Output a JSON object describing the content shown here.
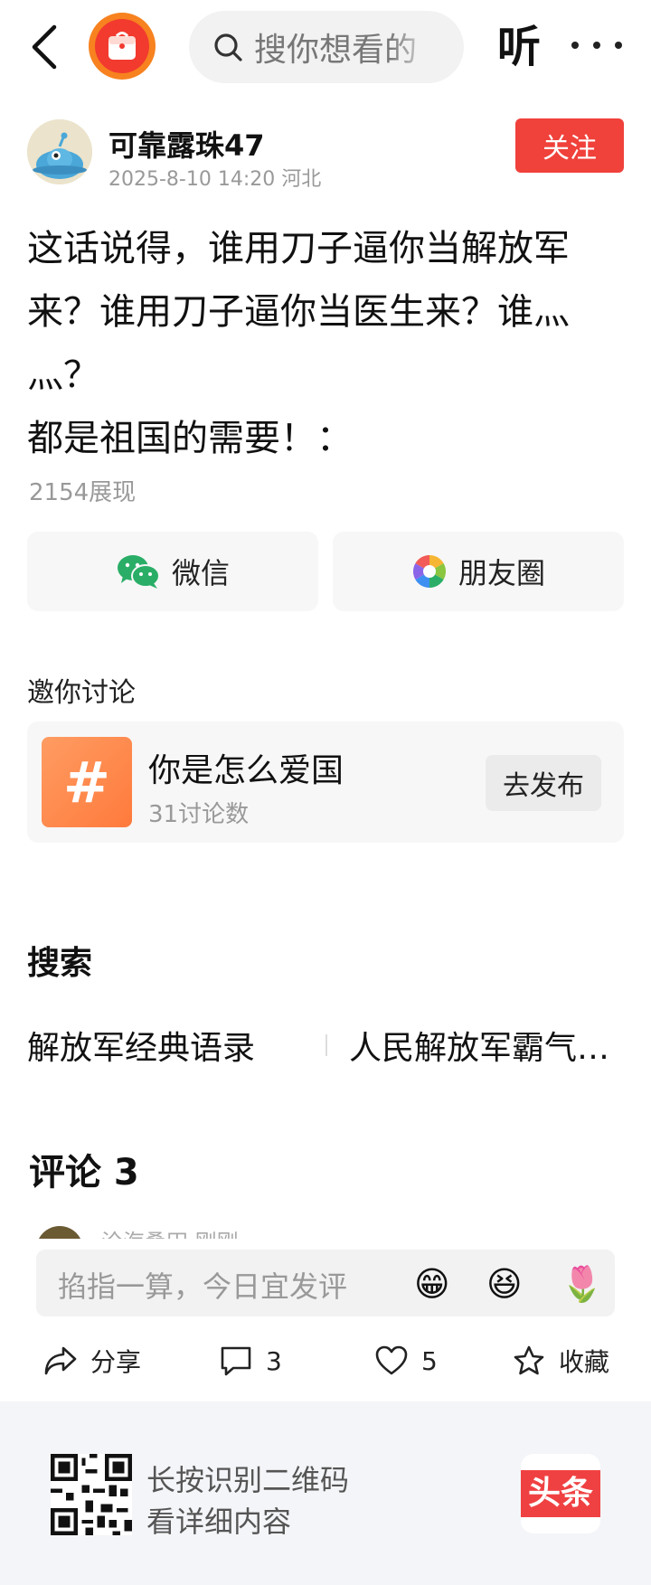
{
  "topbar": {
    "search_placeholder": "搜你想看的",
    "listen_label": "听"
  },
  "author": {
    "name": "可靠露珠47",
    "meta": "2025-8-10 14:20  河北",
    "follow_label": "关注"
  },
  "post": {
    "body": "这话说得，谁用刀子逼你当解放军来？谁用刀子逼你当医生来？谁灬灬？\n都是祖国的需要！：",
    "views": "2154展现"
  },
  "share": {
    "wechat_label": "微信",
    "moments_label": "朋友圈"
  },
  "discussion": {
    "section_title": "邀你讨论",
    "topic_icon": "#",
    "topic_title": "你是怎么爱国",
    "topic_count": "31讨论数",
    "publish_label": "去发布"
  },
  "search": {
    "section_title": "搜索",
    "terms": [
      "解放军经典语录",
      "人民解放军霸气语录"
    ]
  },
  "comments": {
    "title": "评论 3",
    "peek_text": "沧海桑田 刚刚"
  },
  "comment_input": {
    "placeholder": "掐指一算，今日宜发评",
    "emojis": [
      "😁",
      "😆",
      "🌷"
    ]
  },
  "actions": {
    "share_label": "分享",
    "comment_count": "3",
    "like_count": "5",
    "collect_label": "收藏"
  },
  "footer": {
    "qr_line_1": "长按识别二维码",
    "qr_line_2": "看详细内容",
    "logo_text": "头条"
  },
  "colors": {
    "accent_red": "#f0413b",
    "topic_orange": "#ff8a4c",
    "wechat_green": "#2aae67"
  }
}
